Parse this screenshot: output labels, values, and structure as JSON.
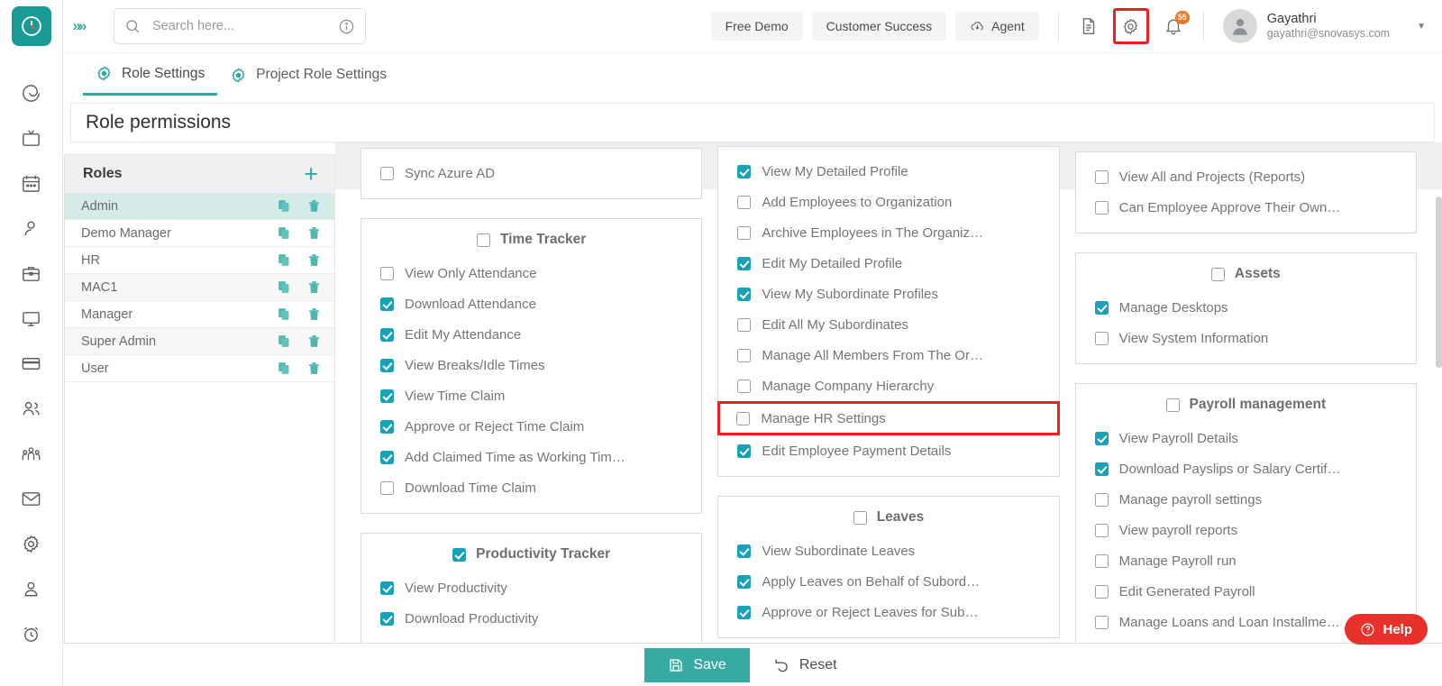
{
  "app": {
    "logo_icon": "clock-logo-icon",
    "expand_icon": "chevrons-right-icon",
    "accent_color": "#2ca7a1",
    "checkbox_color": "#17a2b8",
    "highlight_color": "#f51e1e"
  },
  "search": {
    "placeholder": "Search here...",
    "value": "",
    "icon": "search-icon",
    "info_icon": "info-circle-icon"
  },
  "header": {
    "buttons": [
      {
        "label": "Free Demo",
        "icon": null
      },
      {
        "label": "Customer Success",
        "icon": null
      },
      {
        "label": "Agent",
        "icon": "cloud-download-icon"
      }
    ],
    "icons": [
      {
        "name": "document-icon",
        "highlighted": false
      },
      {
        "name": "gear-icon",
        "highlighted": true
      },
      {
        "name": "bell-icon",
        "highlighted": false
      }
    ],
    "notification_count": "55",
    "user": {
      "name": "Gayathri",
      "email": "gayathri@snovasys.com",
      "avatar_icon": "user-avatar-icon",
      "caret_icon": "caret-down-icon"
    }
  },
  "rail_items": [
    "dashboard-spiral-icon",
    "tv-screen-icon",
    "calendar-icon",
    "person-icon",
    "briefcase-icon",
    "monitor-icon",
    "card-icon",
    "people-icon",
    "team-group-icon",
    "mail-icon",
    "settings-gear-icon",
    "user-badge-icon",
    "alarm-clock-icon"
  ],
  "tabs": [
    {
      "label": "Role Settings",
      "icon": "gear-accent-icon",
      "active": true
    },
    {
      "label": "Project Role Settings",
      "icon": "gear-accent-icon",
      "active": false
    }
  ],
  "page_title": "Role permissions",
  "roles_panel": {
    "header": "Roles",
    "add_icon": "plus-icon",
    "copy_icon": "copy-icon",
    "delete_icon": "trash-icon",
    "items": [
      {
        "name": "Admin",
        "selected": true,
        "alt": false
      },
      {
        "name": "Demo Manager",
        "selected": false,
        "alt": false
      },
      {
        "name": "HR",
        "selected": false,
        "alt": false
      },
      {
        "name": "MAC1",
        "selected": false,
        "alt": true
      },
      {
        "name": "Manager",
        "selected": false,
        "alt": false
      },
      {
        "name": "Super Admin",
        "selected": false,
        "alt": true
      },
      {
        "name": "User",
        "selected": false,
        "alt": false
      }
    ]
  },
  "permissions": {
    "selected_role": "Admin",
    "columns": [
      {
        "cards": [
          {
            "title": null,
            "partial_top": true,
            "items": [
              {
                "label": "Sync Azure AD",
                "checked": false
              }
            ]
          },
          {
            "title": "Time Tracker",
            "title_checked": false,
            "items": [
              {
                "label": "View Only Attendance",
                "checked": false
              },
              {
                "label": "Download Attendance",
                "checked": true
              },
              {
                "label": "Edit My Attendance",
                "checked": true
              },
              {
                "label": "View Breaks/Idle Times",
                "checked": true
              },
              {
                "label": "View Time Claim",
                "checked": true
              },
              {
                "label": "Approve or Reject Time Claim",
                "checked": true
              },
              {
                "label": "Add Claimed Time as Working Tim…",
                "checked": true
              },
              {
                "label": "Download Time Claim",
                "checked": false
              }
            ]
          },
          {
            "title": "Productivity Tracker",
            "title_checked": true,
            "items": [
              {
                "label": "View Productivity",
                "checked": true
              },
              {
                "label": "Download Productivity",
                "checked": true
              }
            ]
          }
        ]
      },
      {
        "cards": [
          {
            "title": null,
            "partial_top": true,
            "items": [
              {
                "label": "View My Detailed Profile",
                "checked": true
              },
              {
                "label": "Add Employees to Organization",
                "checked": false
              },
              {
                "label": "Archive Employees in The Organiz…",
                "checked": false
              },
              {
                "label": "Edit My Detailed Profile",
                "checked": true
              },
              {
                "label": "View My Subordinate Profiles",
                "checked": true
              },
              {
                "label": "Edit All My Subordinates",
                "checked": false
              },
              {
                "label": "Manage All Members From The Or…",
                "checked": false
              },
              {
                "label": "Manage Company Hierarchy",
                "checked": false
              },
              {
                "label": "Manage HR Settings",
                "checked": false,
                "highlighted": true
              },
              {
                "label": "Edit Employee Payment Details",
                "checked": true
              }
            ]
          },
          {
            "title": "Leaves",
            "title_checked": false,
            "items": [
              {
                "label": "View Subordinate Leaves",
                "checked": true
              },
              {
                "label": "Apply Leaves on Behalf of Subord…",
                "checked": true
              },
              {
                "label": "Approve or Reject Leaves for Sub…",
                "checked": true
              }
            ]
          }
        ]
      },
      {
        "cards": [
          {
            "title": null,
            "partial_top": true,
            "items": [
              {
                "label": "View All and Projects (Reports)",
                "checked": false
              },
              {
                "label": "Can Employee Approve Their Own…",
                "checked": false
              }
            ]
          },
          {
            "title": "Assets",
            "title_checked": false,
            "items": [
              {
                "label": "Manage Desktops",
                "checked": true
              },
              {
                "label": "View System Information",
                "checked": false
              }
            ]
          },
          {
            "title": "Payroll management",
            "title_checked": false,
            "items": [
              {
                "label": "View Payroll Details",
                "checked": true
              },
              {
                "label": "Download Payslips or Salary Certif…",
                "checked": true
              },
              {
                "label": "Manage payroll settings",
                "checked": false
              },
              {
                "label": "View payroll reports",
                "checked": false
              },
              {
                "label": "Manage Payroll run",
                "checked": false
              },
              {
                "label": "Edit Generated Payroll",
                "checked": false
              },
              {
                "label": "Manage Loans and Loan Installme…",
                "checked": false
              }
            ]
          }
        ]
      }
    ]
  },
  "footer": {
    "save_label": "Save",
    "save_icon": "floppy-save-icon",
    "reset_label": "Reset",
    "reset_icon": "undo-arrow-icon"
  },
  "help_widget": {
    "label": "Help",
    "icon": "question-circle-icon"
  }
}
